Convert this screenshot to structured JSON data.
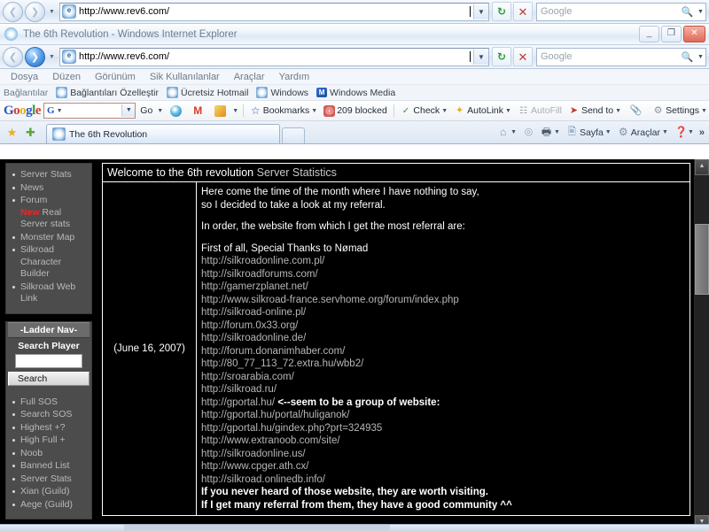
{
  "outer_browser": {
    "address_value": "http://www.rev6.com/",
    "search_placeholder": "Google",
    "back_icon": "back-arrow-icon",
    "forward_icon": "forward-arrow-icon",
    "history_icon": "chevron-down-icon",
    "refresh_icon": "refresh-icon",
    "stop_icon": "stop-icon",
    "search_icon": "search-icon"
  },
  "window": {
    "title": "The 6th Revolution - Windows Internet Explorer",
    "minimize_label": "_",
    "restore_label": "❐",
    "close_label": "✕"
  },
  "browser": {
    "address_value": "http://www.rev6.com/",
    "search_placeholder": "Google"
  },
  "menu": {
    "items": [
      {
        "label": "Dosya"
      },
      {
        "label": "Düzen"
      },
      {
        "label": "Görünüm"
      },
      {
        "label": "Sik Kullanılanlar"
      },
      {
        "label": "Araçlar"
      },
      {
        "label": "Yardım"
      }
    ]
  },
  "links_bar": {
    "label": "Bağlantılar",
    "items": [
      {
        "label": "Bağlantıları Özelleştir",
        "icon": "ie-icon"
      },
      {
        "label": "Ücretsiz Hotmail",
        "icon": "ie-icon"
      },
      {
        "label": "Windows",
        "icon": "ie-icon"
      },
      {
        "label": "Windows Media",
        "icon": "windows-media-icon"
      }
    ]
  },
  "google_toolbar": {
    "logo": {
      "g1": "G",
      "o1": "o",
      "o2": "o",
      "g2": "g",
      "l": "l",
      "e": "e"
    },
    "search_prefix": "G",
    "search_value": "",
    "go_label": "Go",
    "items": [
      {
        "label": "Bookmarks",
        "icon": "star-icon",
        "caret": true
      },
      {
        "label": "209 blocked",
        "icon": "popup-blocker-icon",
        "caret": false
      },
      {
        "label": "Check",
        "icon": "spellcheck-icon",
        "caret": true
      },
      {
        "label": "AutoLink",
        "icon": "autolink-icon",
        "caret": true
      },
      {
        "label": "AutoFill",
        "icon": "autofill-icon",
        "caret": false
      },
      {
        "label": "Send to",
        "icon": "sendto-icon",
        "caret": true
      },
      {
        "label": "Settings",
        "icon": "gear-icon",
        "caret": true
      }
    ]
  },
  "tabs": {
    "favorites_icon": "favorites-star-icon",
    "addfav_icon": "add-to-favorites-icon",
    "active_tab_label": "The 6th Revolution",
    "new_tab_label": ""
  },
  "command_bar": {
    "items": [
      {
        "label": "",
        "icon": "home-icon",
        "caret": true
      },
      {
        "label": "",
        "icon": "feed-icon",
        "caret": false
      },
      {
        "label": "",
        "icon": "print-icon",
        "caret": true
      },
      {
        "label": "Sayfa",
        "icon": "page-icon",
        "caret": true
      },
      {
        "label": "Araçlar",
        "icon": "tools-icon",
        "caret": true
      },
      {
        "label": "",
        "icon": "help-icon",
        "caret": true
      }
    ],
    "overflow_label": "»"
  },
  "sidebar": {
    "main_links": [
      {
        "label": "Server Stats",
        "new": false
      },
      {
        "label": "News",
        "new": false
      },
      {
        "label": "Forum",
        "new": false
      },
      {
        "label": "Real Server stats",
        "new": true,
        "new_tag": "New"
      },
      {
        "label": "Monster Map",
        "new": false
      },
      {
        "label": "Silkroad Character Builder",
        "new": false
      },
      {
        "label": "Silkroad Web Link",
        "new": false
      }
    ],
    "ladder_nav_title": "-Ladder Nav-",
    "search_player_label": "Search Player",
    "search_input_value": "",
    "search_button_label": "Search",
    "ladder_links": [
      {
        "label": "Full SOS"
      },
      {
        "label": "Search SOS"
      },
      {
        "label": "Highest +?"
      },
      {
        "label": "High Full +"
      },
      {
        "label": "Noob"
      },
      {
        "label": "Banned List"
      },
      {
        "label": "Server Stats"
      },
      {
        "label": "Xian (Guild)"
      },
      {
        "label": "Aege (Guild)"
      }
    ]
  },
  "page": {
    "header_main": "Welcome  to the 6th revolution ",
    "header_sub": "Server Statistics",
    "date": "(June 16, 2007)",
    "intro_line1": "Here come the time of the month where I have nothing to say,",
    "intro_line2": "so I decided to take a look at my referral.",
    "intro_line3": "In order, the website from which I get the most referral are:",
    "thanks_line": "First of all, Special Thanks to Nømad",
    "links": [
      {
        "url": "http://silkroadonline.com.pl/",
        "note": ""
      },
      {
        "url": "http://silkroadforums.com/",
        "note": ""
      },
      {
        "url": "http://gamerzplanet.net/",
        "note": ""
      },
      {
        "url": "http://www.silkroad-france.servhome.org/forum/index.php",
        "note": ""
      },
      {
        "url": "http://silkroad-online.pl/",
        "note": ""
      },
      {
        "url": "http://forum.0x33.org/",
        "note": ""
      },
      {
        "url": "http://silkroadonline.de/",
        "note": ""
      },
      {
        "url": "http://forum.donanimhaber.com/",
        "note": ""
      },
      {
        "url": "http://80_77_113_72.extra.hu/wbb2/",
        "note": ""
      },
      {
        "url": "http://sroarabia.com/",
        "note": ""
      },
      {
        "url": "http://silkroad.ru/",
        "note": ""
      },
      {
        "url": "http://gportal.hu/",
        "note": "<--seem to be a group of website:"
      },
      {
        "url": "http://gportal.hu/portal/huliganok/",
        "note": ""
      },
      {
        "url": "http://gportal.hu/gindex.php?prt=324935",
        "note": ""
      },
      {
        "url": "http://www.extranoob.com/site/",
        "note": ""
      },
      {
        "url": "http://silkroadonline.us/",
        "note": ""
      },
      {
        "url": "http://www.cpger.ath.cx/",
        "note": ""
      },
      {
        "url": "http://silkroad.onlinedb.info/",
        "note": ""
      }
    ],
    "closing_line1": "If you never heard of those website, they are worth visiting.",
    "closing_line2": "If I get many referral from them, they have a good community ^^"
  },
  "scrollbar": {
    "up_label": "▲",
    "down_label": "▼"
  }
}
